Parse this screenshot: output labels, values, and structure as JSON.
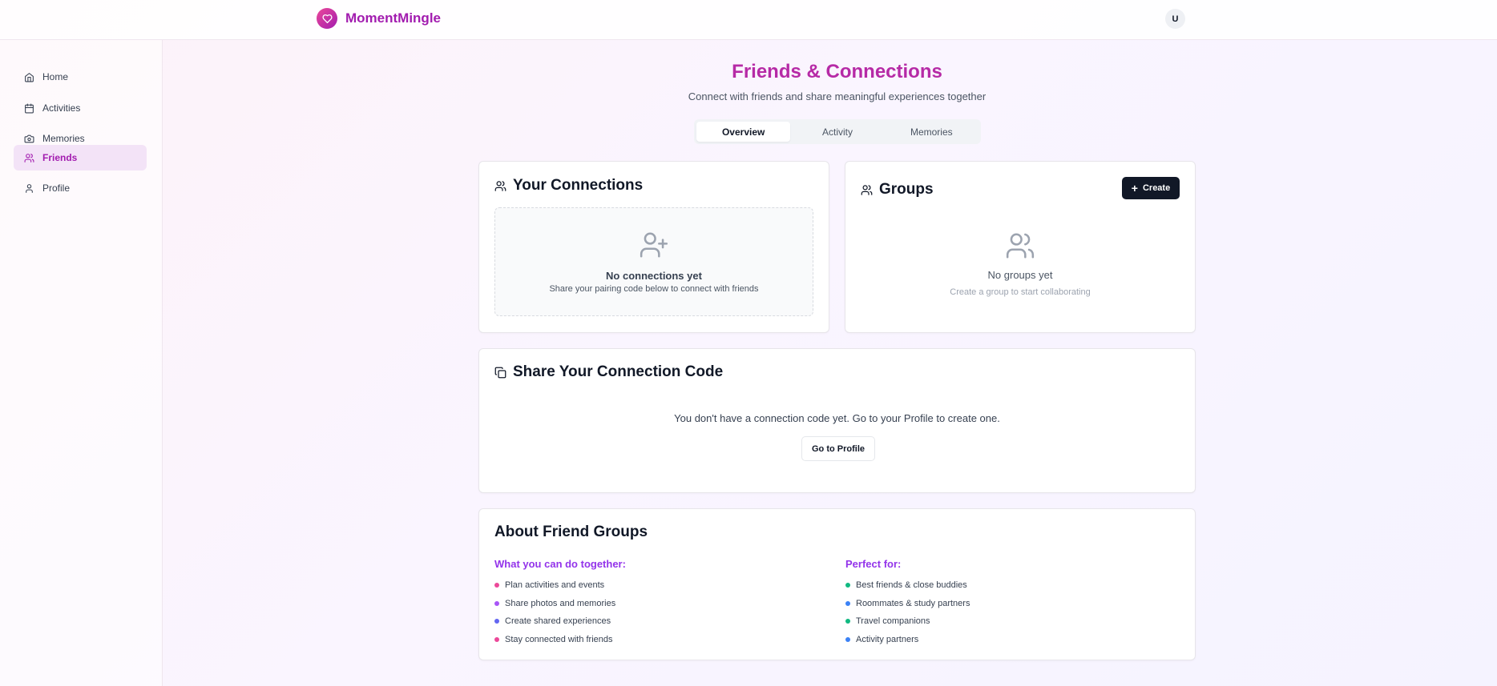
{
  "app": {
    "name": "MomentMingle",
    "avatar_initial": "U"
  },
  "sidebar": {
    "items": [
      {
        "label": "Home",
        "icon": "home-icon"
      },
      {
        "label": "Activities",
        "icon": "calendar-icon"
      },
      {
        "label": "Memories",
        "icon": "camera-icon"
      },
      {
        "label": "Friends",
        "icon": "users-icon",
        "active": true
      },
      {
        "label": "Profile",
        "icon": "user-icon"
      }
    ]
  },
  "header": {
    "title": "Friends & Connections",
    "subtitle": "Connect with friends and share meaningful experiences together"
  },
  "tabs": [
    {
      "label": "Overview",
      "active": true
    },
    {
      "label": "Activity"
    },
    {
      "label": "Memories"
    }
  ],
  "connections": {
    "title": "Your Connections",
    "empty_title": "No connections yet",
    "empty_sub": "Share your pairing code below to connect with friends"
  },
  "groups": {
    "title": "Groups",
    "create_label": "Create",
    "empty_title": "No groups yet",
    "empty_sub": "Create a group to start collaborating"
  },
  "share_code": {
    "title": "Share Your Connection Code",
    "message": "You don't have a connection code yet. Go to your Profile to create one.",
    "button_label": "Go to Profile"
  },
  "about": {
    "title": "About Friend Groups",
    "left": {
      "heading": "What you can do together:",
      "items": [
        "Plan activities and events",
        "Share photos and memories",
        "Create shared experiences",
        "Stay connected with friends"
      ]
    },
    "right": {
      "heading": "Perfect for:",
      "items": [
        "Best friends & close buddies",
        "Roommates & study partners",
        "Travel companions",
        "Activity partners"
      ]
    }
  },
  "colors": {
    "brand": "#a21caf",
    "title": "#b62aa6",
    "dot_pink": "#ec4899",
    "dot_purple": "#a855f7",
    "dot_blue": "#6366f1",
    "dot_green": "#10b981",
    "dot_sky": "#3b82f6"
  }
}
